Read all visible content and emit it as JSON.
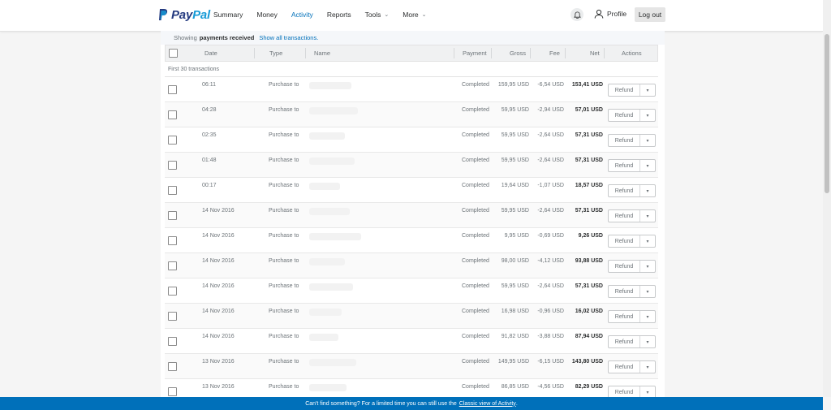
{
  "brand": {
    "pay": "Pay",
    "pal": "Pal"
  },
  "nav": [
    {
      "label": "Summary",
      "active": false,
      "chevron": false
    },
    {
      "label": "Money",
      "active": false,
      "chevron": false
    },
    {
      "label": "Activity",
      "active": true,
      "chevron": false
    },
    {
      "label": "Reports",
      "active": false,
      "chevron": false
    },
    {
      "label": "Tools",
      "active": false,
      "chevron": true
    },
    {
      "label": "More",
      "active": false,
      "chevron": true
    }
  ],
  "profile": {
    "label": "Profile"
  },
  "logout": {
    "label": "Log out"
  },
  "summary": {
    "prefix": "Showing",
    "bold": "payments received",
    "link": "Show all transactions."
  },
  "table": {
    "headers": {
      "date": "Date",
      "type": "Type",
      "name": "Name",
      "payment": "Payment",
      "gross": "Gross",
      "fee": "Fee",
      "net": "Net",
      "actions": "Actions"
    },
    "caption": "First 30 transactions",
    "refund_label": "Refund",
    "rows": [
      {
        "date": "06:11",
        "type": "Purchase to",
        "status": "Completed",
        "gross": "159,95 USD",
        "fee": "-6,54 USD",
        "net": "153,41 USD"
      },
      {
        "date": "04:28",
        "type": "Purchase to",
        "status": "Completed",
        "gross": "59,95 USD",
        "fee": "-2,94 USD",
        "net": "57,01 USD"
      },
      {
        "date": "02:35",
        "type": "Purchase to",
        "status": "Completed",
        "gross": "59,95 USD",
        "fee": "-2,64 USD",
        "net": "57,31 USD"
      },
      {
        "date": "01:48",
        "type": "Purchase to",
        "status": "Completed",
        "gross": "59,95 USD",
        "fee": "-2,64 USD",
        "net": "57,31 USD"
      },
      {
        "date": "00:17",
        "type": "Purchase to",
        "status": "Completed",
        "gross": "19,64 USD",
        "fee": "-1,07 USD",
        "net": "18,57 USD"
      },
      {
        "date": "14 Nov 2016",
        "type": "Purchase to",
        "status": "Completed",
        "gross": "59,95 USD",
        "fee": "-2,64 USD",
        "net": "57,31 USD"
      },
      {
        "date": "14 Nov 2016",
        "type": "Purchase to",
        "status": "Completed",
        "gross": "9,95 USD",
        "fee": "-0,69 USD",
        "net": "9,26 USD"
      },
      {
        "date": "14 Nov 2016",
        "type": "Purchase to",
        "status": "Completed",
        "gross": "98,00 USD",
        "fee": "-4,12 USD",
        "net": "93,88 USD"
      },
      {
        "date": "14 Nov 2016",
        "type": "Purchase to",
        "status": "Completed",
        "gross": "59,95 USD",
        "fee": "-2,64 USD",
        "net": "57,31 USD"
      },
      {
        "date": "14 Nov 2016",
        "type": "Purchase to",
        "status": "Completed",
        "gross": "16,98 USD",
        "fee": "-0,96 USD",
        "net": "16,02 USD"
      },
      {
        "date": "14 Nov 2016",
        "type": "Purchase to",
        "status": "Completed",
        "gross": "91,82 USD",
        "fee": "-3,88 USD",
        "net": "87,94 USD"
      },
      {
        "date": "13 Nov 2016",
        "type": "Purchase to",
        "status": "Completed",
        "gross": "149,95 USD",
        "fee": "-6,15 USD",
        "net": "143,80 USD"
      },
      {
        "date": "13 Nov 2016",
        "type": "Purchase to",
        "status": "Completed",
        "gross": "86,85 USD",
        "fee": "-4,56 USD",
        "net": "82,29 USD"
      }
    ]
  },
  "footer": {
    "text": "Can't find something? For a limited time you can still use the",
    "link": "Classic view of Activity",
    "end": "."
  },
  "colors": {
    "brand_dark": "#253b80",
    "brand_light": "#179bd7",
    "link": "#0070ba",
    "footer_bg": "#0070ba"
  },
  "icons": {
    "bell": "bell-icon",
    "profile": "user-icon",
    "dropdown": "chevron-down-icon"
  }
}
